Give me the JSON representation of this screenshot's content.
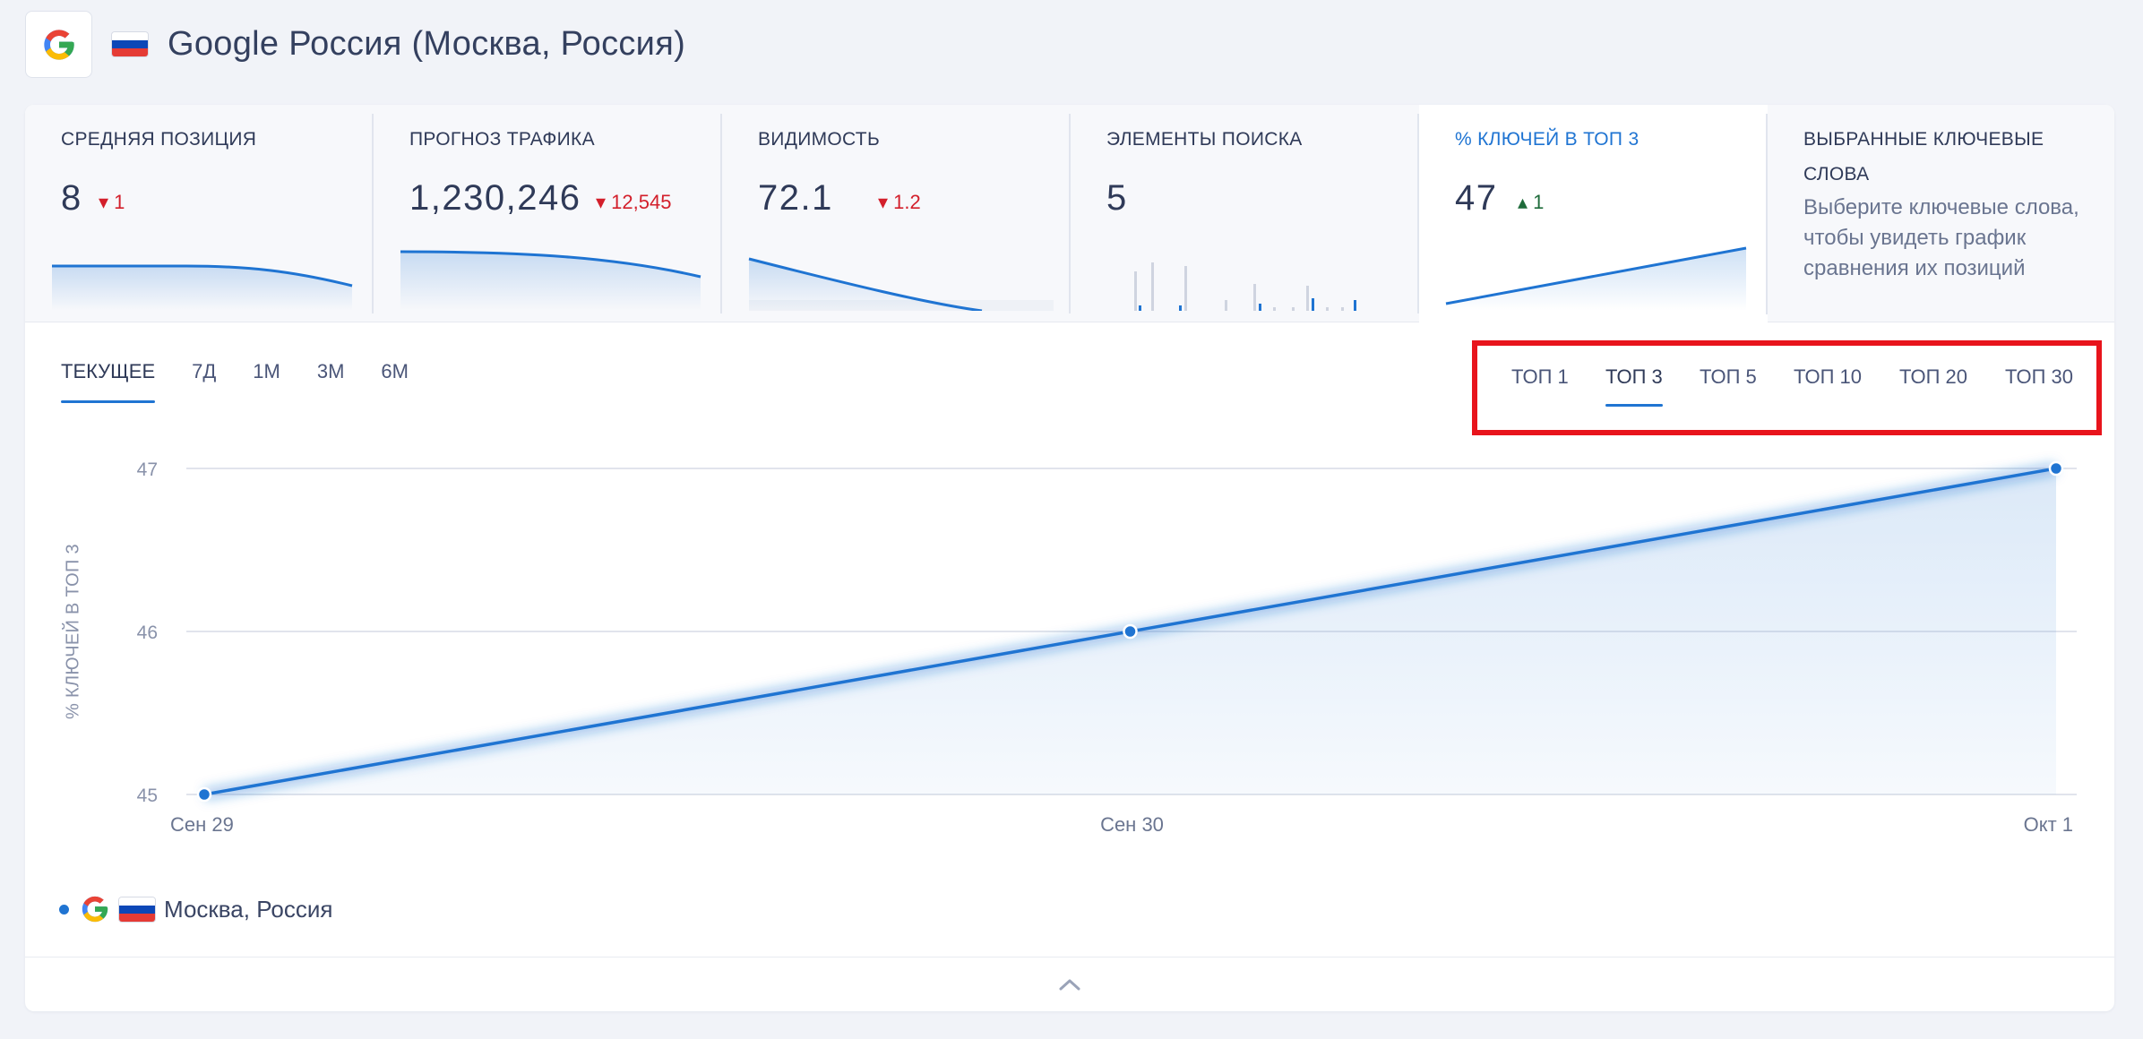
{
  "header": {
    "title": "Google Россия (Москва, Россия)"
  },
  "metrics": [
    {
      "label": "СРЕДНЯЯ ПОЗИЦИЯ",
      "value": "8",
      "delta": "1",
      "direction": "down"
    },
    {
      "label": "ПРОГНОЗ ТРАФИКА",
      "value": "1,230,246",
      "delta": "12,545",
      "direction": "down"
    },
    {
      "label": "ВИДИМОСТЬ",
      "value": "72.1",
      "delta": "1.2",
      "direction": "down"
    },
    {
      "label": "ЭЛЕМЕНТЫ ПОИСКА",
      "value": "5"
    },
    {
      "label": "% КЛЮЧЕЙ В ТОП 3",
      "value": "47",
      "delta": "1",
      "direction": "up"
    },
    {
      "label": "ВЫБРАННЫЕ КЛЮЧЕВЫЕ СЛОВА",
      "description": "Выберите ключевые слова, чтобы увидеть график сравнения их позиций"
    }
  ],
  "period_tabs": [
    "ТЕКУЩЕЕ",
    "7Д",
    "1М",
    "3М",
    "6М"
  ],
  "period_active": "ТЕКУЩЕЕ",
  "top_tabs": [
    "ТОП 1",
    "ТОП 3",
    "ТОП 5",
    "ТОП 10",
    "ТОП 20",
    "ТОП 30"
  ],
  "top_active": "ТОП 3",
  "colors": {
    "accent": "#1f74d2",
    "down": "#d31f2b",
    "up": "#1e6b3a",
    "highlight": "#e8141c"
  },
  "chart_data": {
    "type": "line",
    "x": [
      "Сен 29",
      "Сен 30",
      "Окт 1"
    ],
    "series": [
      {
        "name": "Москва, Россия",
        "values": [
          45,
          46,
          47
        ]
      }
    ],
    "ylabel": "% КЛЮЧЕЙ В ТОП 3",
    "yticks": [
      45,
      46,
      47
    ],
    "ylim": [
      45,
      47
    ],
    "grid": true
  },
  "legend": {
    "label": "Москва, Россия"
  }
}
